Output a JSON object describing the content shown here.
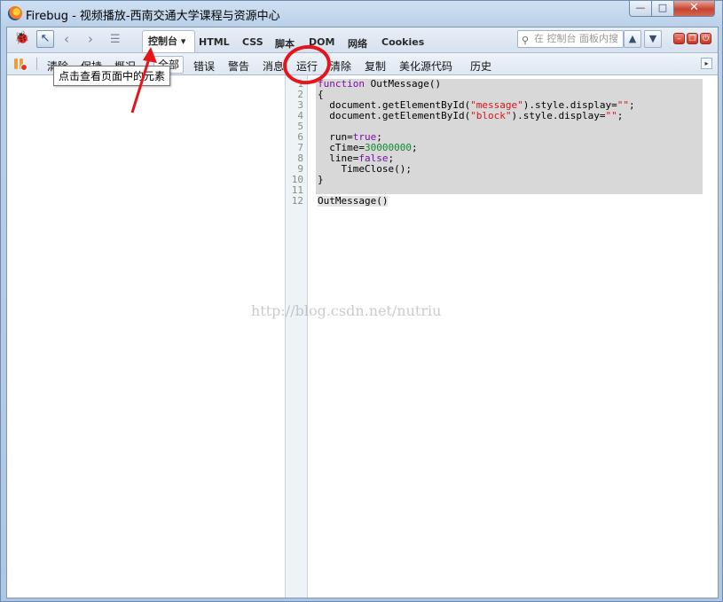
{
  "window": {
    "title": "Firebug - 视频播放-西南交通大学课程与资源中心",
    "min_symbol": "—",
    "max_symbol": "□",
    "close_symbol": "✕"
  },
  "toolbar": {
    "inspect_icon": "pointer-icon",
    "back_symbol": "‹",
    "forward_symbol": "›",
    "list_symbol": "☰",
    "tabs": [
      {
        "label": "控制台 ▾",
        "active": true
      },
      {
        "label": "HTML"
      },
      {
        "label": "CSS"
      },
      {
        "label": "脚本"
      },
      {
        "label": "DOM"
      },
      {
        "label": "网络"
      },
      {
        "label": "Cookies"
      }
    ],
    "search_placeholder": "在 控制台 面板内搜",
    "up_symbol": "▲",
    "down_symbol": "▼",
    "win_controls": [
      "–",
      "❐",
      "⏻"
    ]
  },
  "subtoolbar": {
    "items": [
      {
        "label": "清除"
      },
      {
        "label": "保持"
      },
      {
        "label": "概况"
      },
      {
        "label": "全部",
        "selected": true
      },
      {
        "label": "错误"
      },
      {
        "label": "警告"
      },
      {
        "label": "消息"
      },
      {
        "label": "运行"
      },
      {
        "label": "清除"
      },
      {
        "label": "复制"
      },
      {
        "label": "美化源代码"
      },
      {
        "label": "历史"
      }
    ],
    "scroll_symbol": "▸"
  },
  "tooltip": "点击查看页面中的元素",
  "editor": {
    "line_numbers": [
      "1",
      "2",
      "3",
      "4",
      "5",
      "6",
      "7",
      "8",
      "9",
      "10",
      "11",
      "12"
    ],
    "code": {
      "l1_kw": "function",
      "l1_rest": " OutMessage()",
      "l2": "{",
      "l3_a": "  document.getElementById(",
      "l3_str": "\"message\"",
      "l3_b": ").style.display=",
      "l3_str2": "\"\"",
      "l3_c": ";",
      "l4_a": "  document.getElementById(",
      "l4_str": "\"block\"",
      "l4_b": ").style.display=",
      "l4_str2": "\"\"",
      "l4_c": ";",
      "l6_a": "  run=",
      "l6_kw": "true",
      "l6_b": ";",
      "l7_a": "  cTime=",
      "l7_num": "30000000",
      "l7_b": ";",
      "l8_a": "  line=",
      "l8_kw": "false",
      "l8_b": ";",
      "l9": "    TimeClose();",
      "l10": "}",
      "l12": "OutMessage()"
    }
  },
  "watermark": "http://blog.csdn.net/nutriu",
  "colors": {
    "keyword": "#7a0fa3",
    "string": "#d4161c",
    "number": "#108a2e",
    "annotation": "#e4161b"
  }
}
